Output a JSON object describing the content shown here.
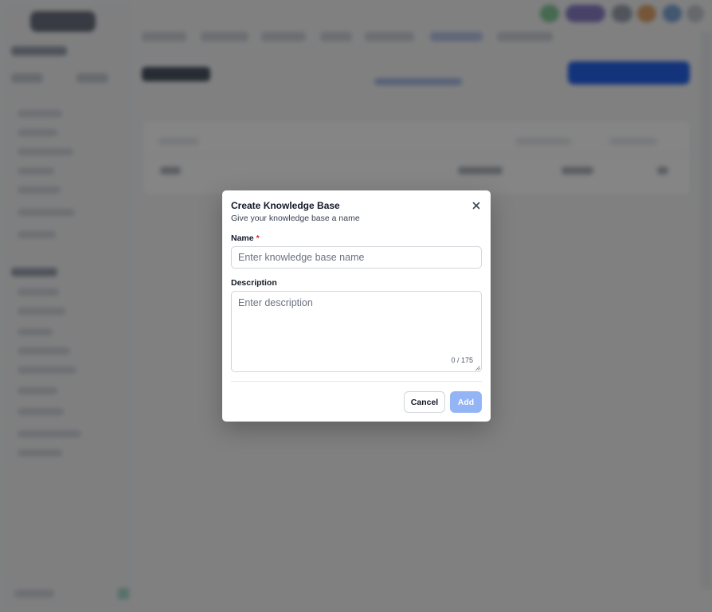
{
  "dialog": {
    "title": "Create Knowledge Base",
    "subtitle": "Give your knowledge base a name",
    "name_label": "Name",
    "required_marker": "*",
    "name_placeholder": "Enter knowledge base name",
    "name_value": "",
    "description_label": "Description",
    "description_placeholder": "Enter description",
    "description_value": "",
    "char_counter": "0 / 175",
    "cancel_label": "Cancel",
    "add_label": "Add",
    "close_icon": "close-icon"
  },
  "colors": {
    "primary": "#2563eb",
    "primary_disabled": "#93b4f5",
    "required": "#dc2626",
    "overlay": "rgba(0,0,0,0.48)"
  }
}
